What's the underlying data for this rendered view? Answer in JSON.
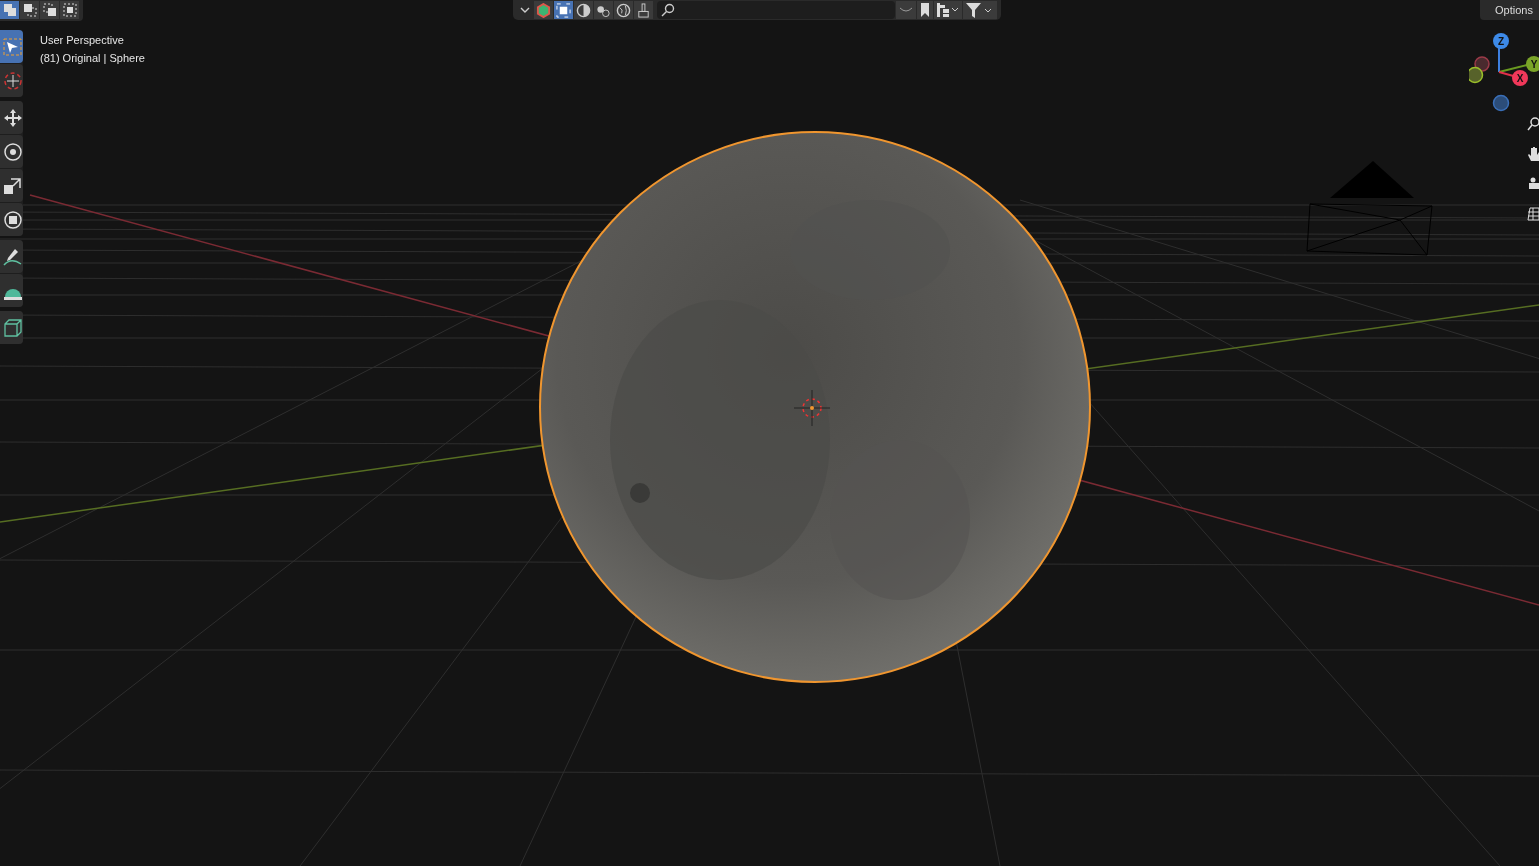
{
  "select_modes": [
    {
      "kind": "new",
      "selected": true
    },
    {
      "kind": "extend",
      "selected": false
    },
    {
      "kind": "subtract",
      "selected": false
    },
    {
      "kind": "intersect",
      "selected": false
    }
  ],
  "header": {
    "toggles": [
      {
        "kind": "colors",
        "selected": false
      },
      {
        "kind": "selectable",
        "selected": true
      },
      {
        "kind": "solid",
        "selected": false
      },
      {
        "kind": "material",
        "selected": false
      },
      {
        "kind": "world",
        "selected": false
      },
      {
        "kind": "brush",
        "selected": false
      }
    ],
    "options": "Options"
  },
  "viewport": {
    "view_name": "User Perspective",
    "object_info": "(81) Original | Sphere"
  },
  "tools": [
    {
      "kind": "select",
      "selected": true
    },
    {
      "kind": "cursor",
      "selected": false
    },
    {
      "kind": "move",
      "selected": false
    },
    {
      "kind": "rotate",
      "selected": false
    },
    {
      "kind": "scale",
      "selected": false
    },
    {
      "kind": "transform",
      "selected": false
    },
    {
      "kind": "annotate",
      "selected": false
    },
    {
      "kind": "measure",
      "selected": false
    },
    {
      "kind": "cube",
      "selected": false
    }
  ],
  "gizmo": {
    "z": "Z",
    "x": "X",
    "y": "Y"
  }
}
